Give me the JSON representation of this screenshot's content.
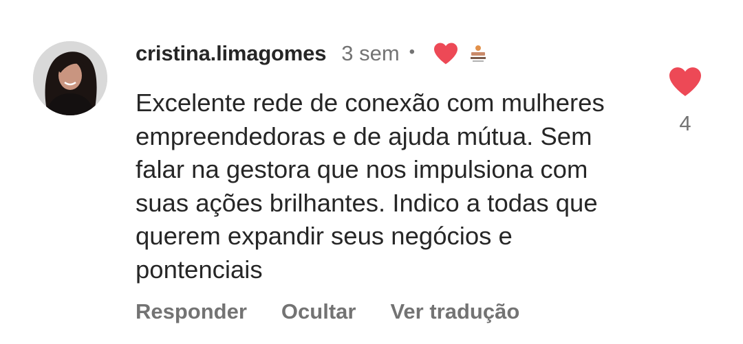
{
  "comment": {
    "username": "cristina.limagomes",
    "timestamp": "3 sem",
    "separator": "•",
    "text": "Excelente rede de conexão com mulheres empreendedoras e de ajuda mútua. Sem falar na gestora que nos impulsiona com suas ações brilhantes. Indico a todas que querem expandir seus negócios e pontenciais",
    "liked_by_creator_icon": "heart-icon",
    "creator_avatar_icon": "creator-avatar"
  },
  "actions": {
    "reply": "Responder",
    "hide": "Ocultar",
    "translate": "Ver tradução"
  },
  "like": {
    "icon": "heart-icon",
    "count": "4"
  },
  "colors": {
    "heart": "#ed4956",
    "secondary_text": "#737373",
    "primary_text": "#262626"
  }
}
